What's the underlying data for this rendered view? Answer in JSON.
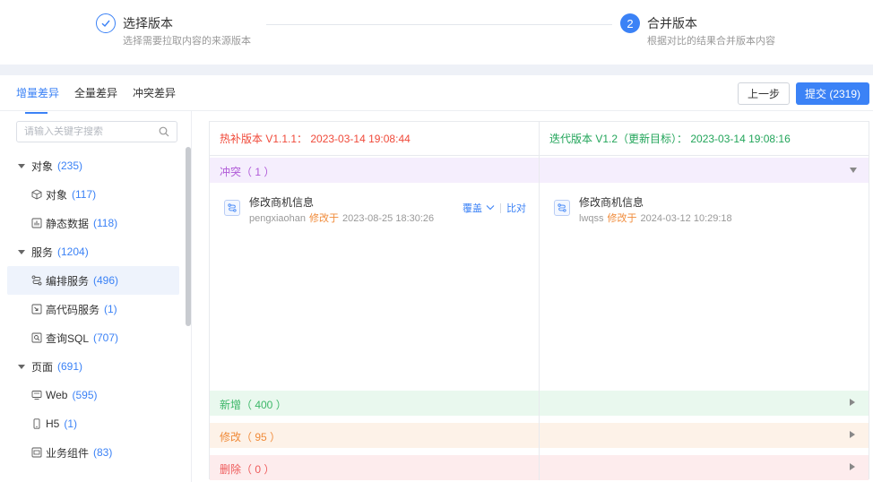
{
  "steps": [
    {
      "title": "选择版本",
      "desc": "选择需要拉取内容的来源版本",
      "status": "done"
    },
    {
      "number": "2",
      "title": "合并版本",
      "desc": "根据对比的结果合并版本内容",
      "status": "active"
    }
  ],
  "tabs": [
    "增量差异",
    "全量差异",
    "冲突差异"
  ],
  "actions": {
    "prev": "上一步",
    "submit": "提交 (2319)"
  },
  "search": {
    "placeholder": "请输入关键字搜索"
  },
  "tree": [
    {
      "label": "对象",
      "count": "(235)"
    },
    {
      "label": "对象",
      "count": "(117)"
    },
    {
      "label": "静态数据",
      "count": "(118)"
    },
    {
      "label": "服务",
      "count": "(1204)"
    },
    {
      "label": "编排服务",
      "count": "(496)"
    },
    {
      "label": "高代码服务",
      "count": "(1)"
    },
    {
      "label": "查询SQL",
      "count": "(707)"
    },
    {
      "label": "页面",
      "count": "(691)"
    },
    {
      "label": "Web",
      "count": "(595)"
    },
    {
      "label": "H5",
      "count": "(1)"
    },
    {
      "label": "业务组件",
      "count": "(83)"
    }
  ],
  "diff": {
    "left_header": "热补版本 V1.1.1： 2023-03-14 19:08:44",
    "right_header": "迭代版本 V1.2（更新目标）： 2023-03-14 19:08:16",
    "sections": {
      "conflict": "冲突（ 1 ）",
      "added": "新增（ 400 ）",
      "modified": "修改（ 95 ）",
      "deleted": "删除（ 0 ）"
    },
    "left_record": {
      "title": "修改商机信息",
      "user": "pengxiaohan",
      "action": "修改于",
      "time": "2023-08-25 18:30:26"
    },
    "right_record": {
      "title": "修改商机信息",
      "user": "lwqss",
      "action": "修改于",
      "time": "2024-03-12 10:29:18"
    },
    "record_actions": {
      "override": "覆盖",
      "compare": "比对"
    }
  },
  "colors": {
    "accent": "#3b82f6",
    "left": "#f04a3a",
    "right": "#22a55a"
  }
}
